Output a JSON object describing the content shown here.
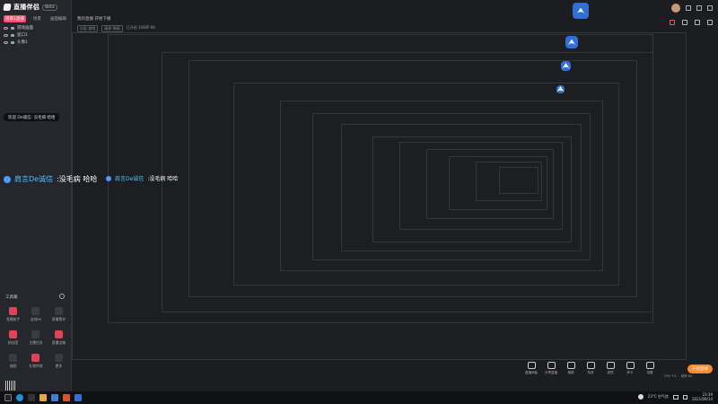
{
  "app": {
    "name": "直播伴侣",
    "version": "Beta"
  },
  "left_tabs": [
    {
      "label": "场景1直播",
      "active": true
    },
    {
      "label": "场景",
      "active": false
    },
    {
      "label": "画面编辑",
      "active": false
    }
  ],
  "scenes": [
    {
      "label": "游戏画面"
    },
    {
      "label": "窗口1"
    },
    {
      "label": "头像1"
    }
  ],
  "chip_text": "欢迎 De诚信: 没毛病 哈哈",
  "overlay": {
    "nickname": "肩言De诚信",
    "message": ":没毛病  哈哈"
  },
  "top_info": {
    "title": "我的直播",
    "line": "开始下播",
    "tags": [
      "分区:游戏",
      "画质:原画",
      "已开启 1080P 60"
    ]
  },
  "toolbox": {
    "title": "工具箱",
    "items": [
      {
        "label": "直播助手",
        "icon": "assistant-icon",
        "red": true
      },
      {
        "label": "连线PK",
        "icon": "pk-icon",
        "red": false
      },
      {
        "label": "直播素材",
        "icon": "material-icon",
        "red": false
      },
      {
        "label": "粉丝团",
        "icon": "fans-icon",
        "red": true
      },
      {
        "label": "主播任务",
        "icon": "task-icon",
        "red": false
      },
      {
        "label": "直播宝箱",
        "icon": "box-icon",
        "red": true
      },
      {
        "label": "福袋",
        "icon": "gift-icon",
        "red": false
      },
      {
        "label": "礼物特效",
        "icon": "effect-icon",
        "red": true
      },
      {
        "label": "更多",
        "icon": "more-icon",
        "red": false
      }
    ]
  },
  "actions": [
    {
      "label": "直播间装",
      "icon": "decor-icon"
    },
    {
      "label": "分享直播",
      "icon": "share-icon"
    },
    {
      "label": "美颜",
      "icon": "beauty-icon"
    },
    {
      "label": "特效",
      "icon": "effect2-icon"
    },
    {
      "label": "滤镜",
      "icon": "filter-icon"
    },
    {
      "label": "声卡",
      "icon": "audio-icon"
    },
    {
      "label": "设置",
      "icon": "settings-icon"
    }
  ],
  "live_button": "开始直播",
  "status": [
    "CPU 7%",
    "帧率 60"
  ],
  "taskbar": {
    "weather": "23°C 空气良",
    "time": "23:39",
    "date": "2021/09/14"
  },
  "colors": {
    "accent": "#ff4d6d",
    "live": "#ff8a2b",
    "nick": "#45c3ff"
  }
}
